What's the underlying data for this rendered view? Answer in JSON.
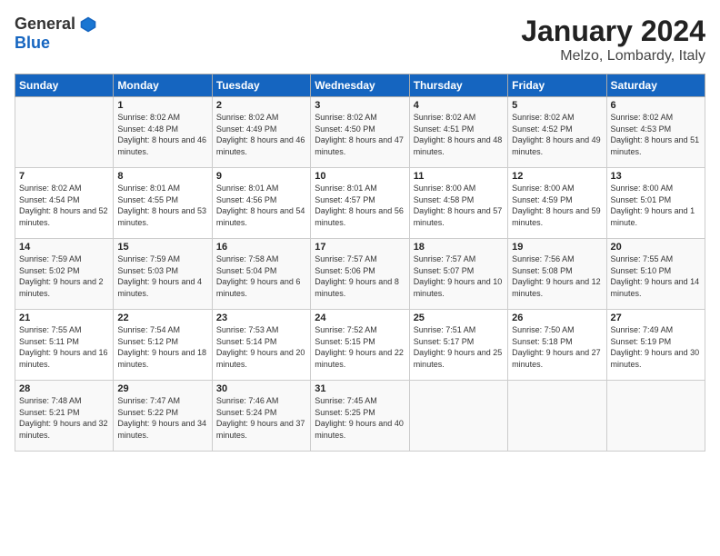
{
  "header": {
    "logo_general": "General",
    "logo_blue": "Blue",
    "title": "January 2024",
    "subtitle": "Melzo, Lombardy, Italy"
  },
  "columns": [
    "Sunday",
    "Monday",
    "Tuesday",
    "Wednesday",
    "Thursday",
    "Friday",
    "Saturday"
  ],
  "weeks": [
    [
      {
        "day": "",
        "sunrise": "",
        "sunset": "",
        "daylight": ""
      },
      {
        "day": "1",
        "sunrise": "Sunrise: 8:02 AM",
        "sunset": "Sunset: 4:48 PM",
        "daylight": "Daylight: 8 hours and 46 minutes."
      },
      {
        "day": "2",
        "sunrise": "Sunrise: 8:02 AM",
        "sunset": "Sunset: 4:49 PM",
        "daylight": "Daylight: 8 hours and 46 minutes."
      },
      {
        "day": "3",
        "sunrise": "Sunrise: 8:02 AM",
        "sunset": "Sunset: 4:50 PM",
        "daylight": "Daylight: 8 hours and 47 minutes."
      },
      {
        "day": "4",
        "sunrise": "Sunrise: 8:02 AM",
        "sunset": "Sunset: 4:51 PM",
        "daylight": "Daylight: 8 hours and 48 minutes."
      },
      {
        "day": "5",
        "sunrise": "Sunrise: 8:02 AM",
        "sunset": "Sunset: 4:52 PM",
        "daylight": "Daylight: 8 hours and 49 minutes."
      },
      {
        "day": "6",
        "sunrise": "Sunrise: 8:02 AM",
        "sunset": "Sunset: 4:53 PM",
        "daylight": "Daylight: 8 hours and 51 minutes."
      }
    ],
    [
      {
        "day": "7",
        "sunrise": "Sunrise: 8:02 AM",
        "sunset": "Sunset: 4:54 PM",
        "daylight": "Daylight: 8 hours and 52 minutes."
      },
      {
        "day": "8",
        "sunrise": "Sunrise: 8:01 AM",
        "sunset": "Sunset: 4:55 PM",
        "daylight": "Daylight: 8 hours and 53 minutes."
      },
      {
        "day": "9",
        "sunrise": "Sunrise: 8:01 AM",
        "sunset": "Sunset: 4:56 PM",
        "daylight": "Daylight: 8 hours and 54 minutes."
      },
      {
        "day": "10",
        "sunrise": "Sunrise: 8:01 AM",
        "sunset": "Sunset: 4:57 PM",
        "daylight": "Daylight: 8 hours and 56 minutes."
      },
      {
        "day": "11",
        "sunrise": "Sunrise: 8:00 AM",
        "sunset": "Sunset: 4:58 PM",
        "daylight": "Daylight: 8 hours and 57 minutes."
      },
      {
        "day": "12",
        "sunrise": "Sunrise: 8:00 AM",
        "sunset": "Sunset: 4:59 PM",
        "daylight": "Daylight: 8 hours and 59 minutes."
      },
      {
        "day": "13",
        "sunrise": "Sunrise: 8:00 AM",
        "sunset": "Sunset: 5:01 PM",
        "daylight": "Daylight: 9 hours and 1 minute."
      }
    ],
    [
      {
        "day": "14",
        "sunrise": "Sunrise: 7:59 AM",
        "sunset": "Sunset: 5:02 PM",
        "daylight": "Daylight: 9 hours and 2 minutes."
      },
      {
        "day": "15",
        "sunrise": "Sunrise: 7:59 AM",
        "sunset": "Sunset: 5:03 PM",
        "daylight": "Daylight: 9 hours and 4 minutes."
      },
      {
        "day": "16",
        "sunrise": "Sunrise: 7:58 AM",
        "sunset": "Sunset: 5:04 PM",
        "daylight": "Daylight: 9 hours and 6 minutes."
      },
      {
        "day": "17",
        "sunrise": "Sunrise: 7:57 AM",
        "sunset": "Sunset: 5:06 PM",
        "daylight": "Daylight: 9 hours and 8 minutes."
      },
      {
        "day": "18",
        "sunrise": "Sunrise: 7:57 AM",
        "sunset": "Sunset: 5:07 PM",
        "daylight": "Daylight: 9 hours and 10 minutes."
      },
      {
        "day": "19",
        "sunrise": "Sunrise: 7:56 AM",
        "sunset": "Sunset: 5:08 PM",
        "daylight": "Daylight: 9 hours and 12 minutes."
      },
      {
        "day": "20",
        "sunrise": "Sunrise: 7:55 AM",
        "sunset": "Sunset: 5:10 PM",
        "daylight": "Daylight: 9 hours and 14 minutes."
      }
    ],
    [
      {
        "day": "21",
        "sunrise": "Sunrise: 7:55 AM",
        "sunset": "Sunset: 5:11 PM",
        "daylight": "Daylight: 9 hours and 16 minutes."
      },
      {
        "day": "22",
        "sunrise": "Sunrise: 7:54 AM",
        "sunset": "Sunset: 5:12 PM",
        "daylight": "Daylight: 9 hours and 18 minutes."
      },
      {
        "day": "23",
        "sunrise": "Sunrise: 7:53 AM",
        "sunset": "Sunset: 5:14 PM",
        "daylight": "Daylight: 9 hours and 20 minutes."
      },
      {
        "day": "24",
        "sunrise": "Sunrise: 7:52 AM",
        "sunset": "Sunset: 5:15 PM",
        "daylight": "Daylight: 9 hours and 22 minutes."
      },
      {
        "day": "25",
        "sunrise": "Sunrise: 7:51 AM",
        "sunset": "Sunset: 5:17 PM",
        "daylight": "Daylight: 9 hours and 25 minutes."
      },
      {
        "day": "26",
        "sunrise": "Sunrise: 7:50 AM",
        "sunset": "Sunset: 5:18 PM",
        "daylight": "Daylight: 9 hours and 27 minutes."
      },
      {
        "day": "27",
        "sunrise": "Sunrise: 7:49 AM",
        "sunset": "Sunset: 5:19 PM",
        "daylight": "Daylight: 9 hours and 30 minutes."
      }
    ],
    [
      {
        "day": "28",
        "sunrise": "Sunrise: 7:48 AM",
        "sunset": "Sunset: 5:21 PM",
        "daylight": "Daylight: 9 hours and 32 minutes."
      },
      {
        "day": "29",
        "sunrise": "Sunrise: 7:47 AM",
        "sunset": "Sunset: 5:22 PM",
        "daylight": "Daylight: 9 hours and 34 minutes."
      },
      {
        "day": "30",
        "sunrise": "Sunrise: 7:46 AM",
        "sunset": "Sunset: 5:24 PM",
        "daylight": "Daylight: 9 hours and 37 minutes."
      },
      {
        "day": "31",
        "sunrise": "Sunrise: 7:45 AM",
        "sunset": "Sunset: 5:25 PM",
        "daylight": "Daylight: 9 hours and 40 minutes."
      },
      {
        "day": "",
        "sunrise": "",
        "sunset": "",
        "daylight": ""
      },
      {
        "day": "",
        "sunrise": "",
        "sunset": "",
        "daylight": ""
      },
      {
        "day": "",
        "sunrise": "",
        "sunset": "",
        "daylight": ""
      }
    ]
  ]
}
